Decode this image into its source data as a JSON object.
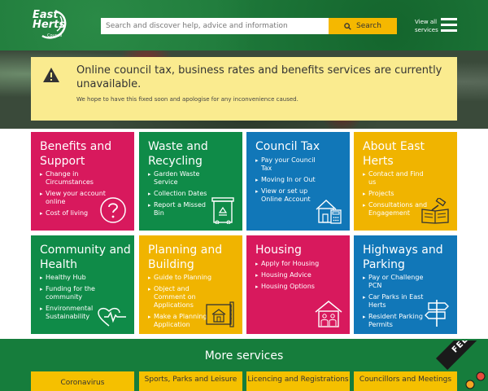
{
  "header": {
    "logo_line1": "East",
    "logo_line2": "Herts",
    "logo_small": "Council",
    "search_placeholder": "Search and discover help, advice and information",
    "search_button": "Search",
    "view_all_line1": "View all",
    "view_all_line2": "services"
  },
  "alert": {
    "title": "Online council tax, business rates and benefits services are currently unavailable.",
    "subtitle": "We hope to have this fixed soon and apologise for any inconvenience caused."
  },
  "tiles": [
    {
      "title": "Benefits and Support",
      "icon": "question-icon",
      "color": "#d8195d",
      "links": [
        "Change in Circumstances",
        "View your account online",
        "Cost of living"
      ]
    },
    {
      "title": "Waste and Recycling",
      "icon": "recycle-bin-icon",
      "color": "#0f8b48",
      "links": [
        "Garden Waste Service",
        "Collection Dates",
        "Report a Missed Bin"
      ]
    },
    {
      "title": "Council Tax",
      "icon": "house-calculator-icon",
      "color": "#1177b8",
      "links": [
        "Pay your Council Tax",
        "Moving In or Out",
        "View or set up Online Account"
      ]
    },
    {
      "title": "About East Herts",
      "icon": "book-gavel-icon",
      "color": "#f0b400",
      "links": [
        "Contact and Find us",
        "Projects",
        "Consultations and Engagement"
      ]
    },
    {
      "title": "Community and Health",
      "icon": "heart-pulse-icon",
      "color": "#0f8b48",
      "links": [
        "Healthy Hub",
        "Funding for the community",
        "Environmental Sustainability"
      ]
    },
    {
      "title": "Planning and Building",
      "icon": "blueprint-icon",
      "color": "#f0b400",
      "links": [
        "Guide to Planning",
        "Object and Comment on Applications",
        "Make a Planning Application"
      ]
    },
    {
      "title": "Housing",
      "icon": "house-family-icon",
      "color": "#d8195d",
      "links": [
        "Apply for Housing",
        "Housing Advice",
        "Housing Options"
      ]
    },
    {
      "title": "Highways and Parking",
      "icon": "signpost-icon",
      "color": "#1177b8",
      "links": [
        "Pay or Challenge PCN",
        "Car Parks in East Herts",
        "Resident Parking Permits"
      ]
    }
  ],
  "more_services": {
    "title": "More services",
    "items": [
      "Coronavirus",
      "Sports, Parks and Leisure",
      "Licencing and Registrations",
      "Councillors and Meetings"
    ]
  },
  "feedback_label": "FEEDBACK"
}
